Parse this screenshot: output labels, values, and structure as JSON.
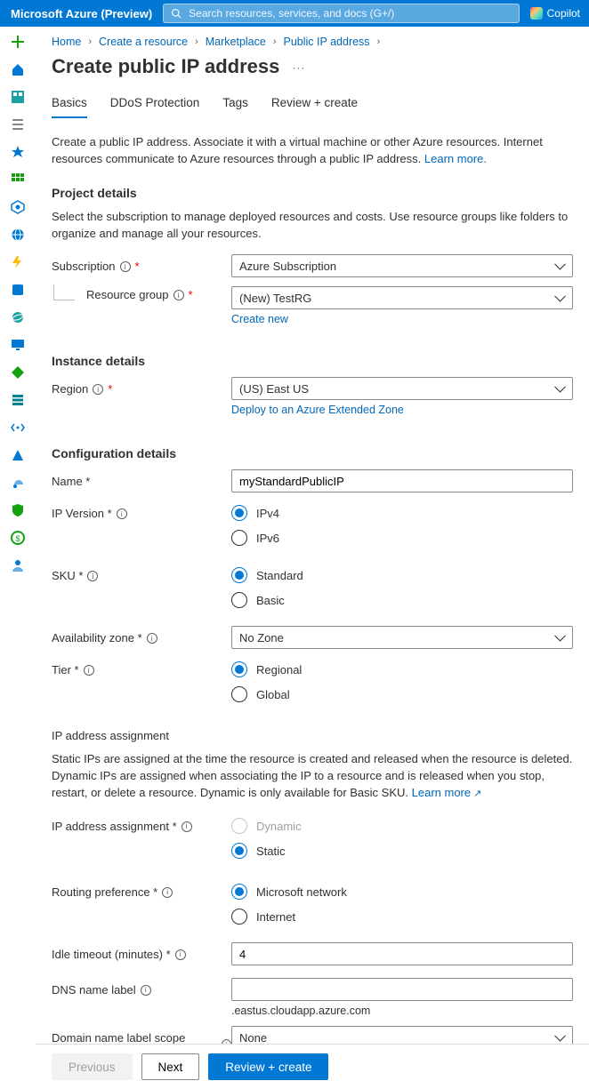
{
  "topbar": {
    "brand": "Microsoft Azure (Preview)",
    "search_placeholder": "Search resources, services, and docs (G+/)",
    "copilot_label": "Copilot"
  },
  "breadcrumb": {
    "items": [
      "Home",
      "Create a resource",
      "Marketplace",
      "Public IP address"
    ]
  },
  "page": {
    "title": "Create public IP address"
  },
  "tabs": {
    "items": [
      "Basics",
      "DDoS Protection",
      "Tags",
      "Review + create"
    ],
    "active_index": 0
  },
  "intro": {
    "text": "Create a public IP address. Associate it with a virtual machine or other Azure resources. Internet resources communicate to Azure resources through a public IP address. ",
    "learn_more": "Learn more."
  },
  "sections": {
    "project_details": {
      "heading": "Project details",
      "help": "Select the subscription to manage deployed resources and costs. Use resource groups like folders to organize and manage all your resources.",
      "subscription": {
        "label": "Subscription",
        "value": "Azure Subscription"
      },
      "resource_group": {
        "label": "Resource group",
        "value": "(New) TestRG",
        "create_new": "Create new"
      }
    },
    "instance_details": {
      "heading": "Instance details",
      "region": {
        "label": "Region",
        "value": "(US) East US",
        "extended_link": "Deploy to an Azure Extended Zone"
      }
    },
    "configuration": {
      "heading": "Configuration details",
      "name": {
        "label": "Name *",
        "value": "myStandardPublicIP"
      },
      "ip_version": {
        "label": "IP Version *",
        "options": [
          "IPv4",
          "IPv6"
        ],
        "selected": "IPv4"
      },
      "sku": {
        "label": "SKU *",
        "options": [
          "Standard",
          "Basic"
        ],
        "selected": "Standard"
      },
      "availability_zone": {
        "label": "Availability zone *",
        "value": "No Zone"
      },
      "tier": {
        "label": "Tier *",
        "options": [
          "Regional",
          "Global"
        ],
        "selected": "Regional"
      },
      "ip_assignment_section": {
        "heading": "IP address assignment",
        "help_pre": "Static IPs are assigned at the time the resource is created and released when the resource is deleted. Dynamic IPs are assigned when associating the IP to a resource and is released when you stop, restart, or delete a resource. Dynamic is only available for Basic SKU. ",
        "learn_more": "Learn more"
      },
      "ip_assignment": {
        "label": "IP address assignment *",
        "options": [
          "Dynamic",
          "Static"
        ],
        "disabled_options": [
          "Dynamic"
        ],
        "selected": "Static"
      },
      "routing_preference": {
        "label": "Routing preference *",
        "options": [
          "Microsoft network",
          "Internet"
        ],
        "selected": "Microsoft network"
      },
      "idle_timeout": {
        "label": "Idle timeout (minutes) *",
        "value": "4"
      },
      "dns_name": {
        "label": "DNS name label",
        "value": "",
        "suffix": ".eastus.cloudapp.azure.com"
      },
      "domain_scope": {
        "label": "Domain name label scope (preview)",
        "value": "None"
      }
    }
  },
  "footer": {
    "previous": "Previous",
    "next": "Next",
    "review": "Review + create"
  },
  "leftnav": {
    "items": [
      {
        "name": "add-icon",
        "color": "#13a10e"
      },
      {
        "name": "home-icon",
        "color": "#0078d4"
      },
      {
        "name": "dashboard-icon",
        "color": "#0078d4"
      },
      {
        "name": "menu-icon",
        "color": "#605e5c"
      },
      {
        "name": "star-icon",
        "color": "#0078d4"
      },
      {
        "name": "grid-icon",
        "color": "#13a10e"
      },
      {
        "name": "portal-icon",
        "color": "#0078d4"
      },
      {
        "name": "globe-icon",
        "color": "#0078d4"
      },
      {
        "name": "bolt-icon",
        "color": "#ffb900"
      },
      {
        "name": "sql-icon",
        "color": "#0078d4"
      },
      {
        "name": "planet-icon",
        "color": "#0078d4"
      },
      {
        "name": "monitor-icon",
        "color": "#0078d4"
      },
      {
        "name": "diamond-icon",
        "color": "#13a10e"
      },
      {
        "name": "bars-icon",
        "color": "#00838f"
      },
      {
        "name": "code-icon",
        "color": "#0078d4"
      },
      {
        "name": "office-icon",
        "color": "#0078d4"
      },
      {
        "name": "cloud-icon",
        "color": "#0078d4"
      },
      {
        "name": "shield-icon",
        "color": "#13a10e"
      },
      {
        "name": "cost-icon",
        "color": "#13a10e"
      },
      {
        "name": "person-icon",
        "color": "#0078d4"
      }
    ]
  }
}
